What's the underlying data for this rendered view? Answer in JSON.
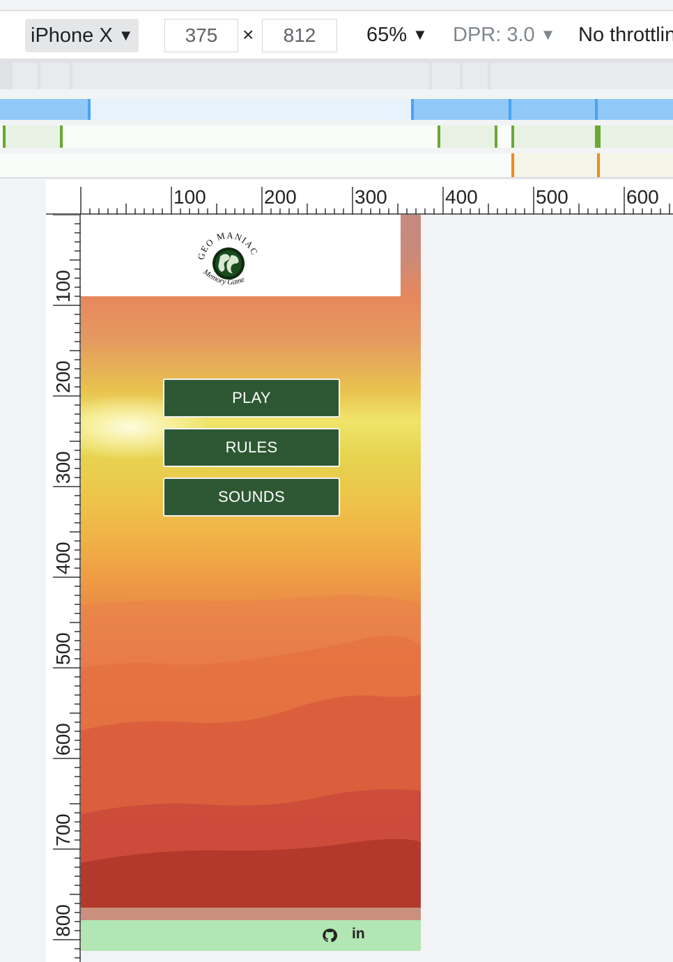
{
  "toolbar": {
    "device": "iPhone X",
    "device_caret": "▼",
    "width_value": "375",
    "times_symbol": "×",
    "height_value": "812",
    "zoom": "65%",
    "zoom_caret": "▼",
    "dpr": "DPR: 3.0",
    "dpr_caret": "▼",
    "throttling": "No throttling"
  },
  "media_query_colors": {
    "blue_strong": "#90c8f8",
    "blue_marker": "#4aa3ef",
    "green_marker": "#6aa832",
    "green_fill": "#e8f2e4",
    "orange_marker": "#f08a1e",
    "orange_fill": "#f4f4e8"
  },
  "ruler": {
    "top_labels": [
      "100",
      "200",
      "300",
      "400",
      "500",
      "600"
    ],
    "left_labels": [
      "100",
      "200",
      "300",
      "400",
      "500",
      "600",
      "700",
      "800"
    ]
  },
  "app": {
    "logo_top_text": "GEO MANIAC",
    "logo_bottom_text": "Memory Game",
    "buttons": {
      "play": "PLAY",
      "rules": "RULES",
      "sounds": "SOUNDS"
    },
    "footer": {
      "github_icon": "github-icon",
      "linkedin_label": "in"
    },
    "colors": {
      "button_bg": "#2e5833",
      "footer_bg": "#b2e6b2",
      "header_bg": "#ffffff"
    }
  }
}
